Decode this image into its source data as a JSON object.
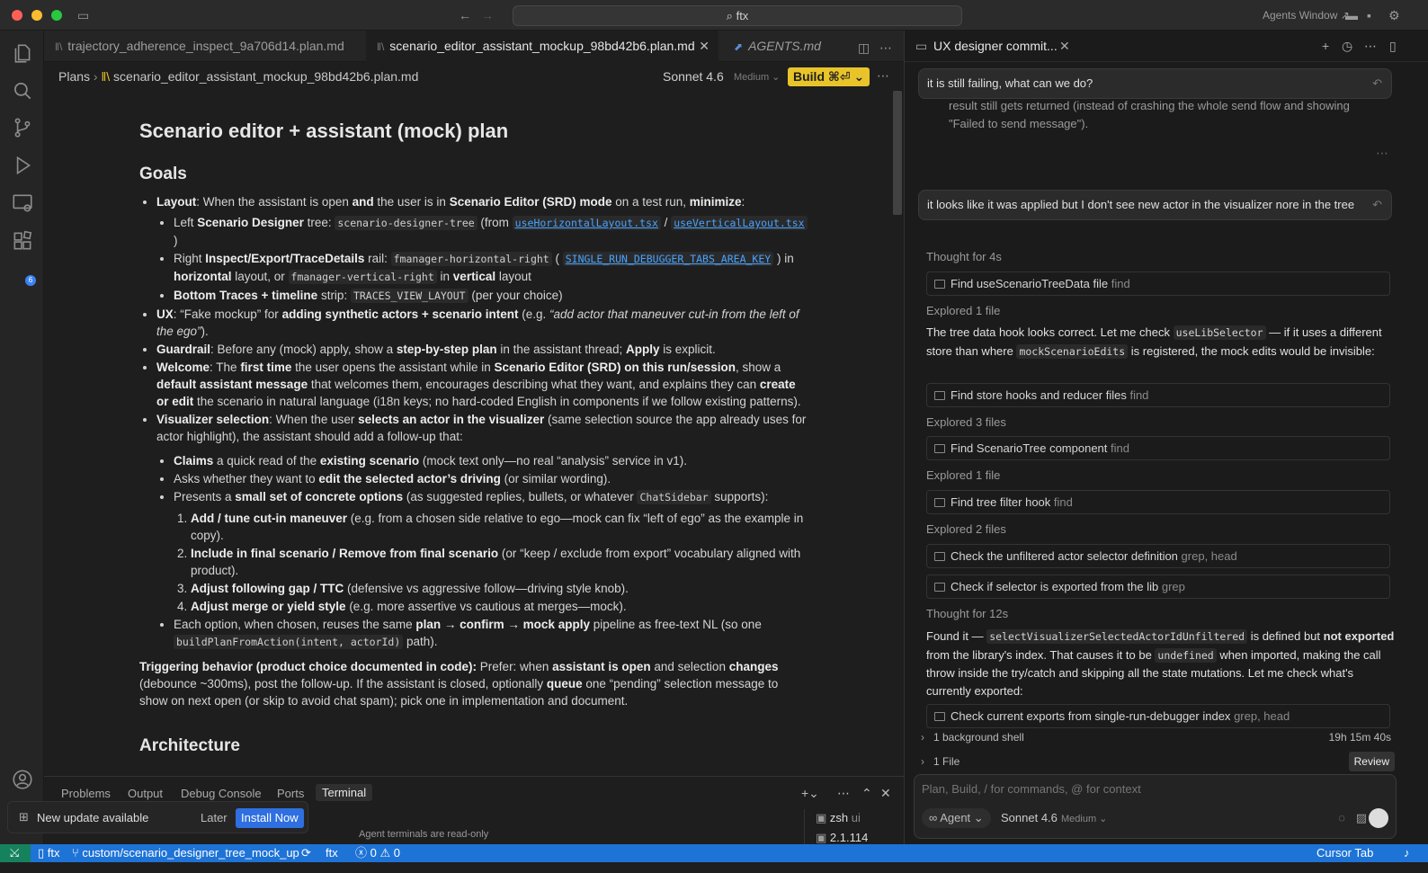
{
  "window": {
    "search": "ftx",
    "agents_window": "Agents Window"
  },
  "tabs": [
    {
      "label": "trajectory_adherence_inspect_9a706d14.plan.md"
    },
    {
      "label": "scenario_editor_assistant_mockup_98bd42b6.plan.md"
    },
    {
      "label": "AGENTS.md"
    }
  ],
  "breadcrumb": {
    "root": "Plans",
    "file": "scenario_editor_assistant_mockup_98bd42b6.plan.md",
    "model": "Sonnet 4.6",
    "effort": "Medium",
    "build": "Build ⌘⏎"
  },
  "doc": {
    "title": "Scenario editor + assistant (mock) plan",
    "goals_heading": "Goals",
    "architecture_heading": "Architecture"
  },
  "panel": {
    "tabs": [
      "Problems",
      "Output",
      "Debug Console",
      "Ports",
      "Terminal"
    ],
    "readonly": "Agent terminals are read-only",
    "terminals": [
      "zsh",
      "ui",
      "2.1.114"
    ]
  },
  "notification": {
    "text": "New update available",
    "later": "Later",
    "install": "Install Now"
  },
  "chat": {
    "title": "UX designer commit...",
    "msg1": "it is still failing, what can we do?",
    "prev_text_1": "result still gets returned (instead of crashing the whole send flow and showing",
    "prev_text_2": "\"Failed to send message\").",
    "msg2": "it looks like it was applied but I don't see new actor in the visualizer nore in the tree",
    "thought1": "Thought",
    "thought1_dur": "for 4s",
    "thought2": "Thought",
    "thought2_dur": "for 12s",
    "tools": [
      {
        "label": "Find useScenarioTreeData file",
        "arg": "find"
      },
      {
        "label": "Find store hooks and reducer files",
        "arg": "find"
      },
      {
        "label": "Find ScenarioTree component",
        "arg": "find"
      },
      {
        "label": "Find tree filter hook",
        "arg": "find"
      },
      {
        "label": "Check the unfiltered actor selector definition",
        "arg": "grep, head"
      },
      {
        "label": "Check if selector is exported from the lib",
        "arg": "grep"
      },
      {
        "label": "Check current exports from single-run-debugger index",
        "arg": "grep, head"
      }
    ],
    "explored": [
      {
        "label": "Explored",
        "count": "1 file"
      },
      {
        "label": "Explored",
        "count": "3 files"
      },
      {
        "label": "Explored",
        "count": "1 file"
      },
      {
        "label": "Explored",
        "count": "2 files"
      }
    ],
    "background_shell": "1 background shell",
    "shell_time": "19h 15m 40s",
    "files": "1 File",
    "review": "Review",
    "input_placeholder": "Plan, Build, / for commands, @ for context",
    "agent": "Agent",
    "model": "Sonnet 4.6",
    "effort": "Medium"
  },
  "status": {
    "repo": "ftx",
    "branch": "custom/scenario_designer_tree_mock_up",
    "workspace": "ftx",
    "errors": "0",
    "warnings": "0",
    "cursor_tab": "Cursor Tab"
  }
}
